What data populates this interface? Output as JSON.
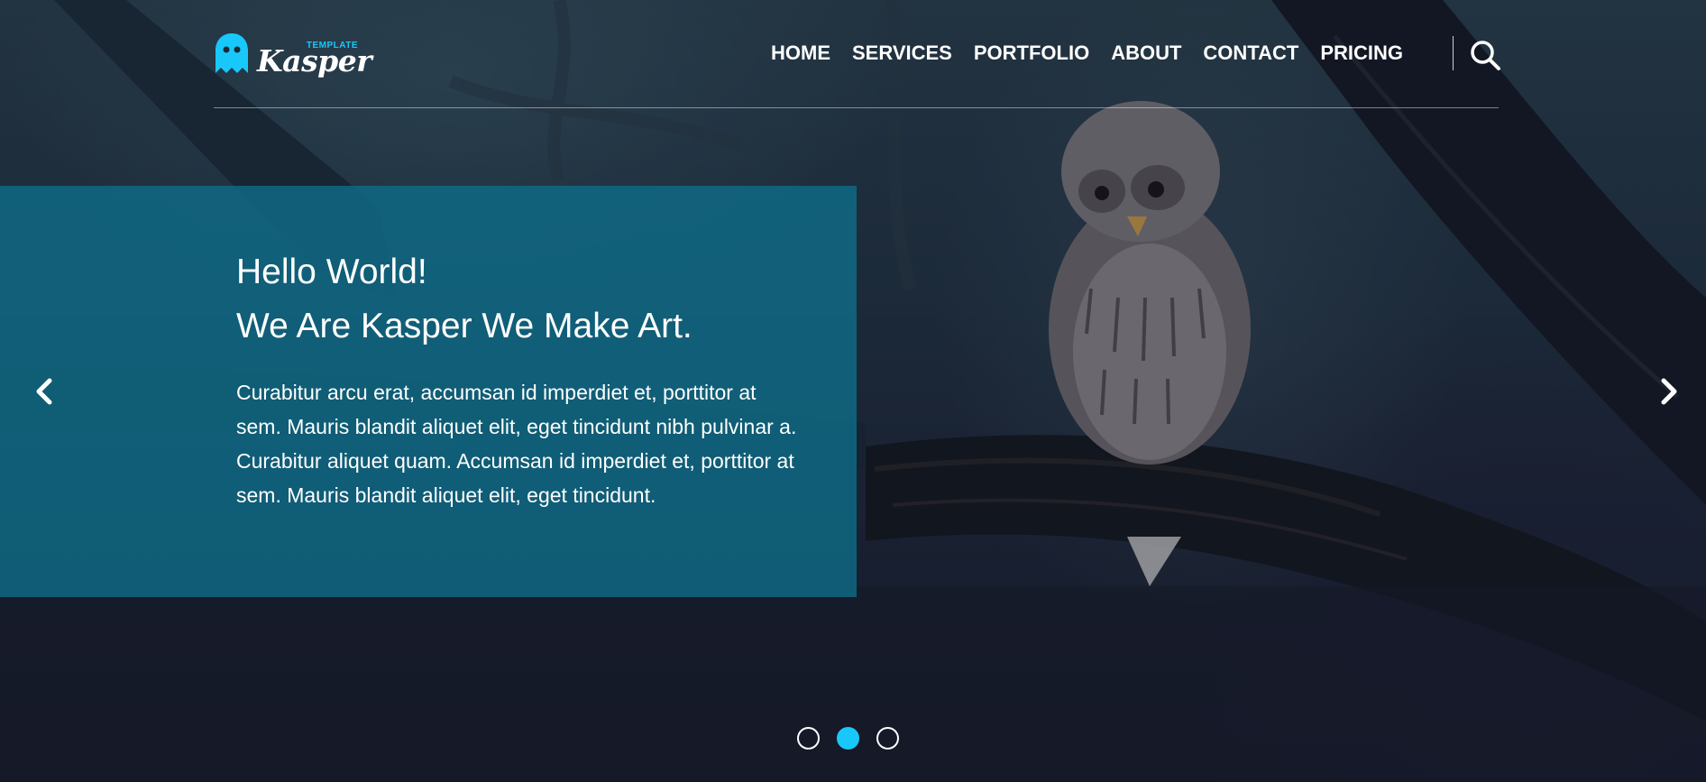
{
  "colors": {
    "accent": "#19c8fa",
    "panel": "#0e6e8a",
    "text": "#ffffff"
  },
  "logo": {
    "small_text": "TEMPLATE",
    "word": "Kasper",
    "icon": "ghost-icon"
  },
  "nav": {
    "items": [
      "HOME",
      "SERVICES",
      "PORTFOLIO",
      "ABOUT",
      "CONTACT",
      "PRICING"
    ],
    "search_icon": "search-icon"
  },
  "hero": {
    "title_line1": "Hello World!",
    "title_line2": "We Are Kasper We Make Art.",
    "body": "Curabitur arcu erat, accumsan id imperdiet et, porttitor at sem. Mauris blandit aliquet elit, eget tincidunt nibh pulvinar a. Curabitur aliquet quam. Accumsan id imperdiet et, porttitor at sem. Mauris blandit aliquet elit, eget tincidunt."
  },
  "slider": {
    "prev_icon": "chevron-left-icon",
    "next_icon": "chevron-right-icon",
    "bullet_count": 3,
    "active_bullet": 2
  }
}
